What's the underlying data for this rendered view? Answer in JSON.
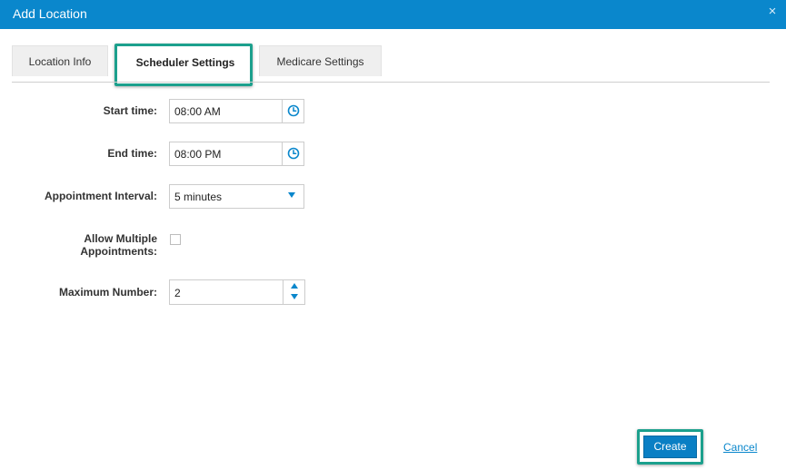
{
  "dialog": {
    "title": "Add Location",
    "close_symbol": "×"
  },
  "tabs": [
    {
      "label": "Location Info",
      "active": false
    },
    {
      "label": "Scheduler Settings",
      "active": true
    },
    {
      "label": "Medicare Settings",
      "active": false
    }
  ],
  "form": {
    "start_time": {
      "label": "Start time:",
      "value": "08:00 AM",
      "icon": "clock-icon"
    },
    "end_time": {
      "label": "End time:",
      "value": "08:00 PM",
      "icon": "clock-icon"
    },
    "appointment_interval": {
      "label": "Appointment Interval:",
      "value": "5 minutes"
    },
    "allow_multiple": {
      "label_line1": "Allow Multiple",
      "label_line2": "Appointments:",
      "checked": false
    },
    "maximum_number": {
      "label": "Maximum Number:",
      "value": "2"
    }
  },
  "actions": {
    "create_label": "Create",
    "cancel_label": "Cancel"
  },
  "colors": {
    "titlebar": "#0a87cc",
    "highlight": "#1ca08d",
    "accent": "#0a87cc"
  }
}
